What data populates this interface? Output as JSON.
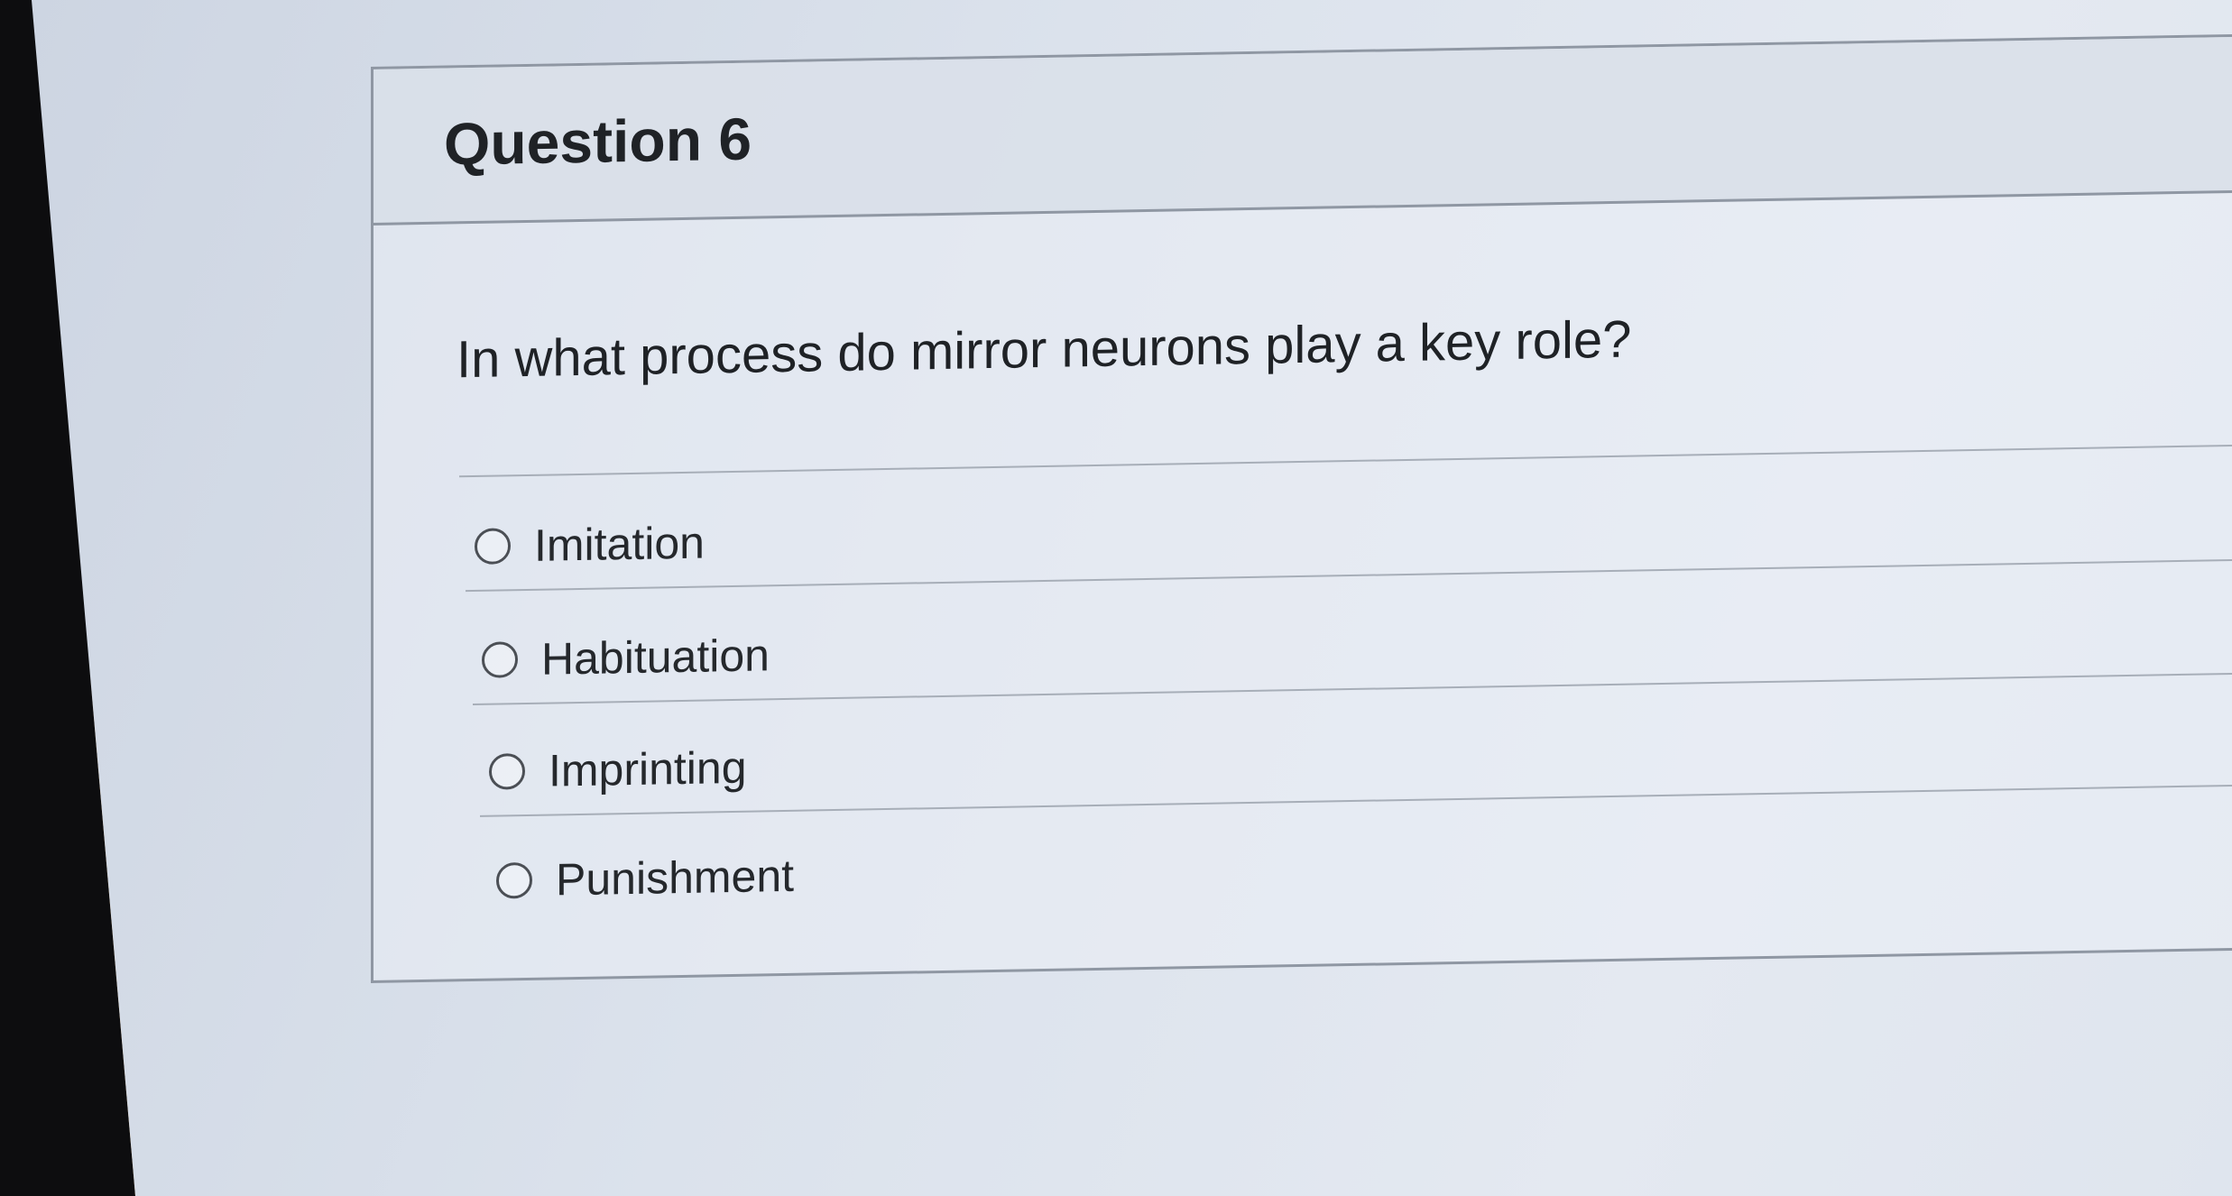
{
  "question": {
    "title": "Question 6",
    "text": "In what process do mirror neurons play a key role?",
    "options": [
      {
        "label": "Imitation",
        "selected": false
      },
      {
        "label": "Habituation",
        "selected": false
      },
      {
        "label": "Imprinting",
        "selected": false
      },
      {
        "label": "Punishment",
        "selected": false
      }
    ]
  }
}
